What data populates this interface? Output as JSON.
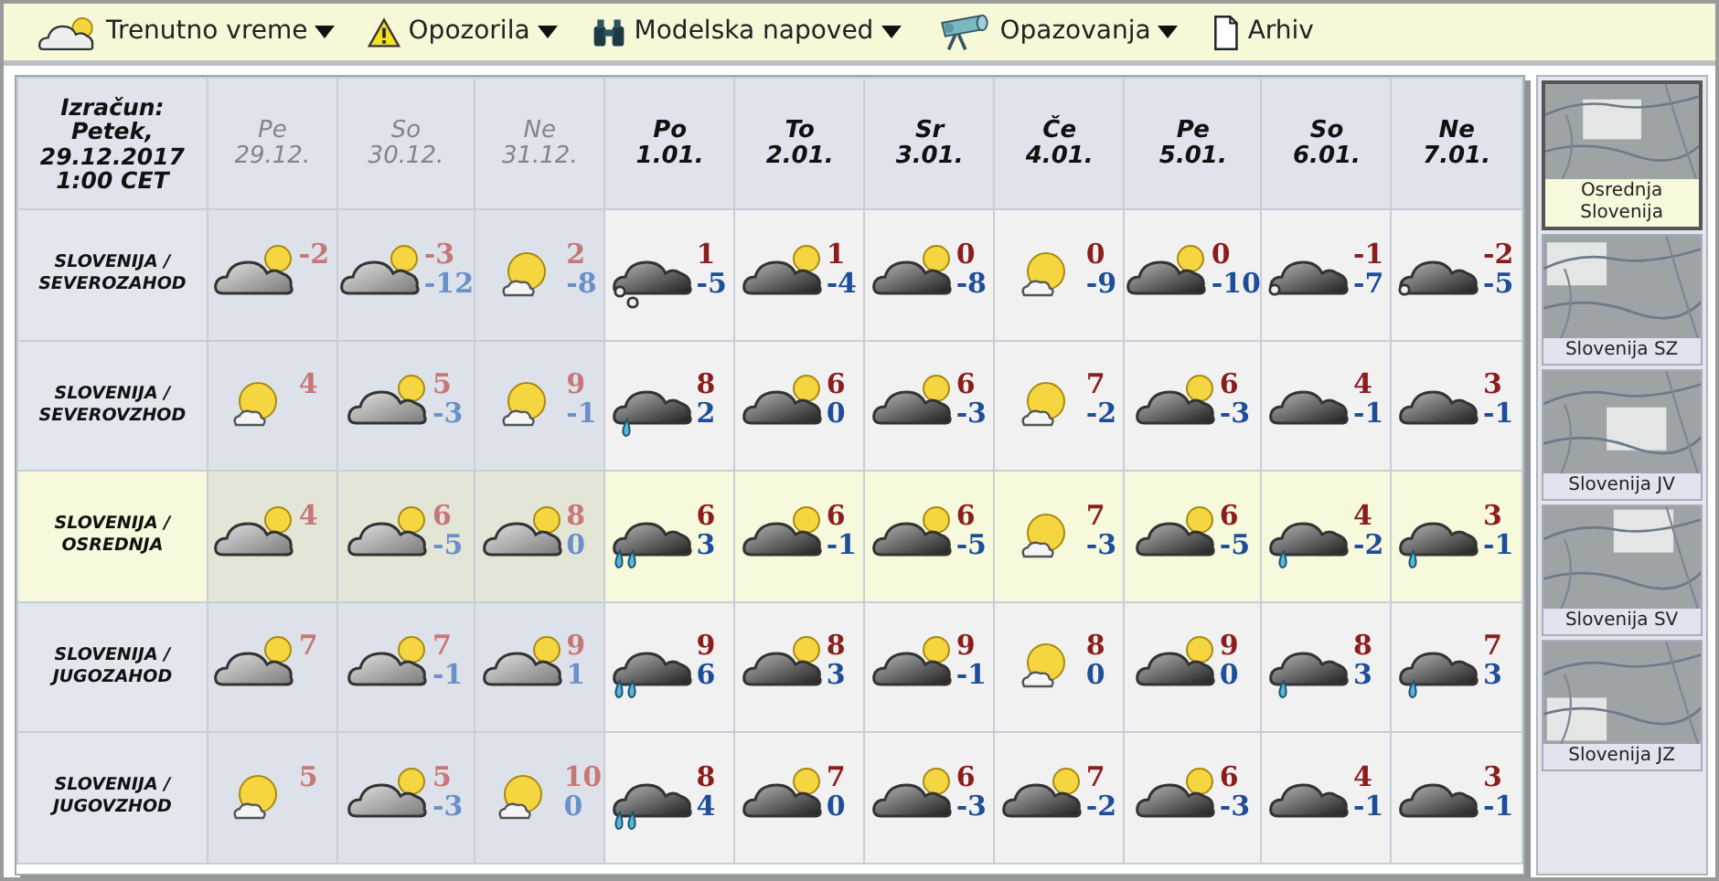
{
  "menu": [
    {
      "label": "Trenutno vreme",
      "dropdown": true
    },
    {
      "label": "Opozorila",
      "dropdown": true
    },
    {
      "label": "Modelska napoved",
      "dropdown": true
    },
    {
      "label": "Opazovanja",
      "dropdown": true
    },
    {
      "label": "Arhiv",
      "dropdown": false
    }
  ],
  "calculation": [
    "Izračun:",
    "Petek,",
    "29.12.2017",
    "1:00 CET"
  ],
  "days": [
    {
      "day": "Pe",
      "date": "29.12.",
      "past": true
    },
    {
      "day": "So",
      "date": "30.12.",
      "past": true
    },
    {
      "day": "Ne",
      "date": "31.12.",
      "past": true
    },
    {
      "day": "Po",
      "date": "1.01.",
      "past": false
    },
    {
      "day": "To",
      "date": "2.01.",
      "past": false
    },
    {
      "day": "Sr",
      "date": "3.01.",
      "past": false
    },
    {
      "day": "Če",
      "date": "4.01.",
      "past": false
    },
    {
      "day": "Pe",
      "date": "5.01.",
      "past": false
    },
    {
      "day": "So",
      "date": "6.01.",
      "past": false
    },
    {
      "day": "Ne",
      "date": "7.01.",
      "past": false
    }
  ],
  "rows": [
    {
      "region": [
        "SLOVENIJA /",
        "SEVEROZAHOD"
      ],
      "selected": false,
      "cells": [
        {
          "kind": "partly",
          "max": "-2"
        },
        {
          "kind": "partly",
          "max": "-3",
          "min": "-12"
        },
        {
          "kind": "sunny",
          "max": "2",
          "min": "-8"
        },
        {
          "kind": "snow",
          "max": "1",
          "min": "-5"
        },
        {
          "kind": "partly",
          "max": "1",
          "min": "-4"
        },
        {
          "kind": "partly",
          "max": "0",
          "min": "-8"
        },
        {
          "kind": "sunny",
          "max": "0",
          "min": "-9"
        },
        {
          "kind": "partly",
          "max": "0",
          "min": "-10"
        },
        {
          "kind": "light-snow",
          "max": "-1",
          "min": "-7"
        },
        {
          "kind": "light-snow",
          "max": "-2",
          "min": "-5"
        }
      ]
    },
    {
      "region": [
        "SLOVENIJA /",
        "SEVEROVZHOD"
      ],
      "selected": false,
      "cells": [
        {
          "kind": "sunny",
          "max": "4"
        },
        {
          "kind": "partly",
          "max": "5",
          "min": "-3"
        },
        {
          "kind": "sunny",
          "max": "9",
          "min": "-1"
        },
        {
          "kind": "rain",
          "max": "8",
          "min": "2"
        },
        {
          "kind": "partly",
          "max": "6",
          "min": "0"
        },
        {
          "kind": "partly",
          "max": "6",
          "min": "-3"
        },
        {
          "kind": "sunny",
          "max": "7",
          "min": "-2"
        },
        {
          "kind": "partly",
          "max": "6",
          "min": "-3"
        },
        {
          "kind": "overcast",
          "max": "4",
          "min": "-1"
        },
        {
          "kind": "overcast",
          "max": "3",
          "min": "-1"
        }
      ]
    },
    {
      "region": [
        "SLOVENIJA /",
        "OSREDNJA"
      ],
      "selected": true,
      "cells": [
        {
          "kind": "partly",
          "max": "4"
        },
        {
          "kind": "partly",
          "max": "6",
          "min": "-5"
        },
        {
          "kind": "partly",
          "max": "8",
          "min": "0"
        },
        {
          "kind": "heavy-rain",
          "max": "6",
          "min": "3"
        },
        {
          "kind": "partly",
          "max": "6",
          "min": "-1"
        },
        {
          "kind": "partly",
          "max": "6",
          "min": "-5"
        },
        {
          "kind": "sunny",
          "max": "7",
          "min": "-3"
        },
        {
          "kind": "partly",
          "max": "6",
          "min": "-5"
        },
        {
          "kind": "rain",
          "max": "4",
          "min": "-2"
        },
        {
          "kind": "rain",
          "max": "3",
          "min": "-1"
        }
      ]
    },
    {
      "region": [
        "SLOVENIJA /",
        "JUGOZAHOD"
      ],
      "selected": false,
      "cells": [
        {
          "kind": "partly",
          "max": "7"
        },
        {
          "kind": "partly",
          "max": "7",
          "min": "-1"
        },
        {
          "kind": "partly",
          "max": "9",
          "min": "1"
        },
        {
          "kind": "heavy-rain",
          "max": "9",
          "min": "6"
        },
        {
          "kind": "partly",
          "max": "8",
          "min": "3"
        },
        {
          "kind": "partly",
          "max": "9",
          "min": "-1"
        },
        {
          "kind": "sunny",
          "max": "8",
          "min": "0"
        },
        {
          "kind": "partly",
          "max": "9",
          "min": "0"
        },
        {
          "kind": "rain",
          "max": "8",
          "min": "3"
        },
        {
          "kind": "rain",
          "max": "7",
          "min": "3"
        }
      ]
    },
    {
      "region": [
        "SLOVENIJA /",
        "JUGOVZHOD"
      ],
      "selected": false,
      "cells": [
        {
          "kind": "sunny",
          "max": "5"
        },
        {
          "kind": "partly",
          "max": "5",
          "min": "-3"
        },
        {
          "kind": "sunny",
          "max": "10",
          "min": "0"
        },
        {
          "kind": "heavy-rain",
          "max": "8",
          "min": "4"
        },
        {
          "kind": "partly",
          "max": "7",
          "min": "0"
        },
        {
          "kind": "partly",
          "max": "6",
          "min": "-3"
        },
        {
          "kind": "partly",
          "max": "7",
          "min": "-2"
        },
        {
          "kind": "partly",
          "max": "6",
          "min": "-3"
        },
        {
          "kind": "overcast",
          "max": "4",
          "min": "-1"
        },
        {
          "kind": "overcast",
          "max": "3",
          "min": "-1"
        }
      ]
    }
  ],
  "maps": [
    {
      "label": "Osrednja Slovenija",
      "selected": true
    },
    {
      "label": "Slovenija SZ",
      "selected": false
    },
    {
      "label": "Slovenija JV",
      "selected": false
    },
    {
      "label": "Slovenija SV",
      "selected": false
    },
    {
      "label": "Slovenija JZ",
      "selected": false
    }
  ]
}
